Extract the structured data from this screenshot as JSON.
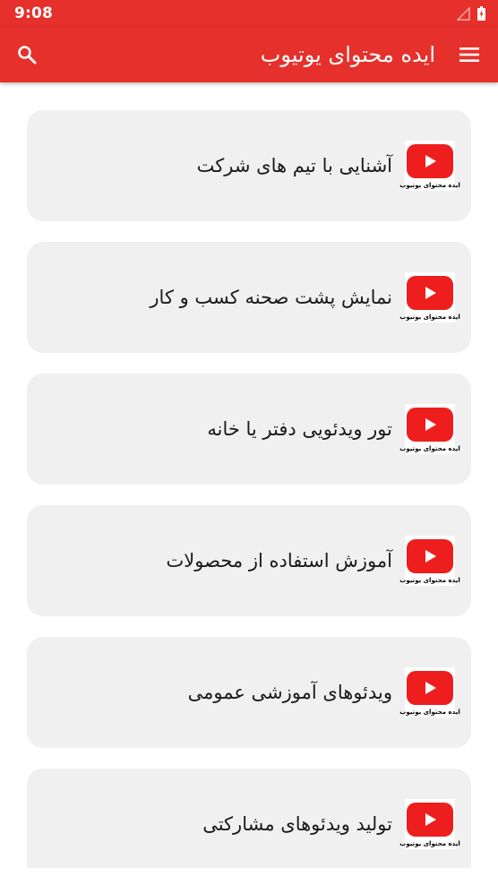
{
  "status": {
    "time": "9:08"
  },
  "appbar": {
    "title": "ایده محتوای یوتیوب",
    "menu_icon": "menu-icon",
    "search_icon": "search-icon"
  },
  "colors": {
    "primary": "#e5302b",
    "card_bg": "#f0f0f0",
    "youtube_red": "#ee1e1e"
  },
  "items": [
    {
      "label": "آشنایی با تیم های شرکت",
      "thumb_caption": "ایده محتوای یوتیوب"
    },
    {
      "label": "نمایش پشت صحنه کسب و کار",
      "thumb_caption": "ایده محتوای یوتیوب"
    },
    {
      "label": "تور ویدئویی دفتر یا خانه",
      "thumb_caption": "ایده محتوای یوتیوب"
    },
    {
      "label": "آموزش استفاده از محصولات",
      "thumb_caption": "ایده محتوای یوتیوب"
    },
    {
      "label": "ویدئوهای آموزشی عمومی",
      "thumb_caption": "ایده محتوای یوتیوب"
    },
    {
      "label": "تولید ویدئوهای مشارکتی",
      "thumb_caption": "ایده محتوای یوتیوب"
    }
  ]
}
